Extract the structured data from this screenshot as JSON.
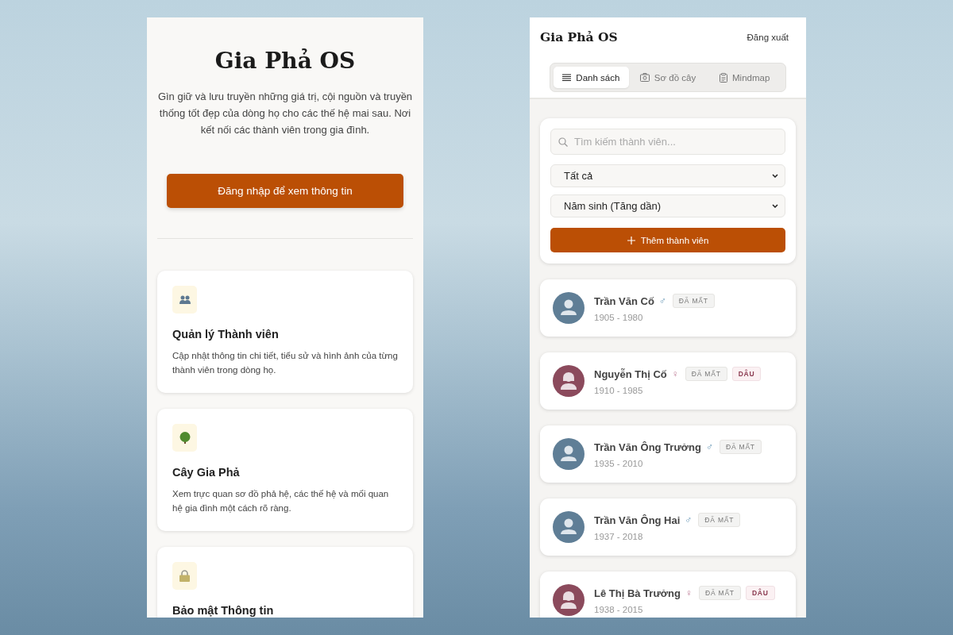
{
  "landing": {
    "title": "Gia Phả OS",
    "description": "Gìn giữ và lưu truyền những giá trị, cội nguồn và truyền thống tốt đẹp của dòng họ cho các thế hệ mai sau. Nơi kết nối các thành viên trong gia đình.",
    "login_button": "Đăng nhập để xem thông tin",
    "features": [
      {
        "kind": "members",
        "title": "Quản lý Thành viên",
        "description": "Cập nhật thông tin chi tiết, tiểu sử và hình ảnh của từng thành viên trong dòng họ."
      },
      {
        "kind": "tree",
        "title": "Cây Gia Phả",
        "description": "Xem trực quan sơ đồ phả hệ, các thế hệ và mối quan hệ gia đình một cách rõ ràng."
      },
      {
        "kind": "security",
        "title": "Bảo mật Thông tin"
      }
    ]
  },
  "app": {
    "title": "Gia Phả OS",
    "logout": "Đăng xuất",
    "tabs": [
      {
        "kind": "list",
        "label": "Danh sách",
        "selected": true
      },
      {
        "kind": "tree",
        "label": "Sơ đồ cây",
        "selected": false
      },
      {
        "kind": "mindmap",
        "label": "Mindmap",
        "selected": false
      }
    ],
    "search": {
      "placeholder": "Tìm kiếm thành viên..."
    },
    "filter": "Tất cả",
    "sort": "Năm sinh (Tăng dần)",
    "add_button": "Thêm thành viên",
    "members": [
      {
        "name": "Trần Văn Cố",
        "kind": "male",
        "symbol": "♂",
        "years": "1905 - 1980",
        "badges": [
          {
            "kind": "deceased",
            "label": "ĐÃ MẤT"
          }
        ]
      },
      {
        "name": "Nguyễn Thị Cố",
        "kind": "female",
        "symbol": "♀",
        "years": "1910 - 1985",
        "badges": [
          {
            "kind": "deceased",
            "label": "ĐÃ MẤT"
          },
          {
            "kind": "in_law",
            "label": "DÂU"
          }
        ]
      },
      {
        "name": "Trần Văn Ông Trưởng",
        "kind": "male",
        "symbol": "♂",
        "years": "1935 - 2010",
        "badges": [
          {
            "kind": "deceased",
            "label": "ĐÃ MẤT"
          }
        ]
      },
      {
        "name": "Trần Văn Ông Hai",
        "kind": "male",
        "symbol": "♂",
        "years": "1937 - 2018",
        "badges": [
          {
            "kind": "deceased",
            "label": "ĐÃ MẤT"
          }
        ]
      },
      {
        "name": "Lê Thị Bà Trưởng",
        "kind": "female",
        "symbol": "♀",
        "years": "1938 - 2015",
        "badges": [
          {
            "kind": "deceased",
            "label": "ĐÃ MẤT"
          },
          {
            "kind": "in_law",
            "label": "DÂU"
          }
        ]
      }
    ]
  }
}
